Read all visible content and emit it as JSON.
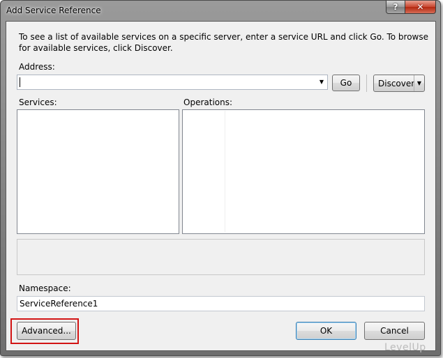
{
  "window": {
    "title": "Add Service Reference",
    "help_glyph": "?",
    "close_glyph": "✕"
  },
  "instructions": "To see a list of available services on a specific server, enter a service URL and click Go. To browse for available services, click Discover.",
  "address": {
    "label": "Address:",
    "value": "",
    "go_label": "Go",
    "discover_label": "Discover"
  },
  "services": {
    "label": "Services:",
    "items": []
  },
  "operations": {
    "label": "Operations:",
    "items": []
  },
  "namespace": {
    "label": "Namespace:",
    "value": "ServiceReference1"
  },
  "buttons": {
    "advanced": "Advanced...",
    "ok": "OK",
    "cancel": "Cancel"
  },
  "watermark": "LevelUp",
  "colors": {
    "highlight": "#d21414",
    "dialog_bg": "#f0f0f0",
    "default_button_border": "#3c7fb1"
  }
}
